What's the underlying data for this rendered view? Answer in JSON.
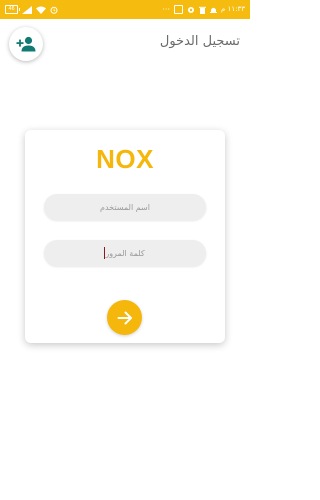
{
  "status_bar": {
    "battery_label": "46",
    "time": "١١:٣٣ م",
    "bg_color": "#f5bb0e"
  },
  "header": {
    "title": "تسجيل الدخول",
    "add_user_icon": "add-user-icon"
  },
  "card": {
    "logo_text": "NOX",
    "username": {
      "placeholder": "اسم المستخدم",
      "value": ""
    },
    "password": {
      "placeholder": "كلمة المرور",
      "value": ""
    },
    "submit_icon": "arrow-right-icon"
  },
  "colors": {
    "accent": "#f5b70c",
    "add_user_icon": "#127a73",
    "title_text": "#6b6b6b"
  }
}
